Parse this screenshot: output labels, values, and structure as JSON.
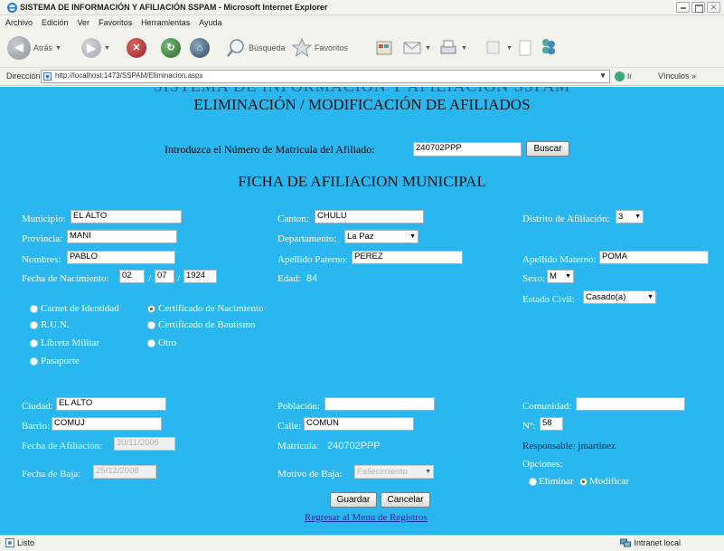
{
  "browser": {
    "window_title": "SISTEMA DE INFORMACIÓN Y AFILIACIÓN SSPAM - Microsoft Internet Explorer",
    "menu": [
      "Archivo",
      "Edición",
      "Ver",
      "Favoritos",
      "Herramientas",
      "Ayuda"
    ],
    "toolbar": {
      "back_label": "Atrás",
      "search_label": "Búsqueda",
      "favorites_label": "Favoritos"
    },
    "address_label": "Dirección",
    "address_url": "http://localhost:1473/SSPAM/Eliminacion.aspx",
    "go_label": "Ir",
    "links_label": "Vínculos",
    "status_text": "Listo",
    "zone_text": "Intranet local"
  },
  "page": {
    "banner_clipped": "SISTEMA DE INFORMACIÓN Y AFILIACIÓN SSPAM",
    "heading": "ELIMINACIÓN / MODIFICACIÓN DE AFILIADOS",
    "search": {
      "label": "Introduzca el Número de Matricula del Afiliado:",
      "value": "240702PPP",
      "button": "Buscar"
    },
    "form_title": "FICHA DE AFILIACION MUNICIPAL",
    "fields": {
      "municipio": {
        "label": "Municipio:",
        "value": "EL ALTO"
      },
      "canton": {
        "label": "Canton:",
        "value": "CHULU"
      },
      "distrito": {
        "label": "Distrito de Afiliación:",
        "value": "3"
      },
      "provincia": {
        "label": "Provincia:",
        "value": "MANI"
      },
      "departamento": {
        "label": "Departamento:",
        "value": "La Paz"
      },
      "nombres": {
        "label": "Nombres:",
        "value": "PABLO"
      },
      "apellido_paterno": {
        "label": "Apellido Paterno:",
        "value": "PEREZ"
      },
      "apellido_materno": {
        "label": "Apellido Materno:",
        "value": "POMA"
      },
      "fecha_nacimiento": {
        "label": "Fecha de Nacimiento:",
        "day": "02",
        "month": "07",
        "year": "1924",
        "sep": "/"
      },
      "edad": {
        "label": "Edad:",
        "value": "84"
      },
      "sexo": {
        "label": "Sexo:",
        "value": "M"
      },
      "estado_civil": {
        "label": "Estado Civil:",
        "value": "Casado(a)"
      },
      "ciudad": {
        "label": "Ciudad:",
        "value": "EL ALTO"
      },
      "poblacion": {
        "label": "Población:",
        "value": ""
      },
      "comunidad": {
        "label": "Comunidad:",
        "value": ""
      },
      "barrio": {
        "label": "Barrio:",
        "value": "COMUJ"
      },
      "calle": {
        "label": "Calle:",
        "value": "COMUN"
      },
      "numero": {
        "label": "Nº:",
        "value": "58"
      },
      "fecha_afiliacion": {
        "label": "Fecha de Afiliación:",
        "value": "30/11/2006"
      },
      "matricula": {
        "label": "Matricula:",
        "value": "240702PPP"
      },
      "responsable": {
        "label": "Responsable:",
        "value": "jmartinez"
      },
      "fecha_baja": {
        "label": "Fecha de Baja:",
        "value": "25/12/2008"
      },
      "motivo_baja": {
        "label": "Motivo de Baja:",
        "value": "Fallecimiento"
      }
    },
    "documents": {
      "options": [
        {
          "label": "Carnet de Identidad",
          "checked": false
        },
        {
          "label": "Certificado de Nacimiento",
          "checked": true
        },
        {
          "label": "R.U.N.",
          "checked": false
        },
        {
          "label": "Certificado de Bautismo",
          "checked": false
        },
        {
          "label": "Libreta Militar",
          "checked": false
        },
        {
          "label": "Otro",
          "checked": false
        },
        {
          "label": "Pasaporte",
          "checked": false
        }
      ]
    },
    "opciones": {
      "label": "Opciones:",
      "eliminar": "Eliminar",
      "modificar": "Modificar",
      "selected": "Modificar"
    },
    "buttons": {
      "guardar": "Guardar",
      "cancelar": "Cancelar"
    },
    "back_link": "Regresar al Menu de Registros"
  },
  "colors": {
    "page_background": "#2ab7f0",
    "link": "#1a2aa0",
    "label_text": "#ffffff"
  }
}
